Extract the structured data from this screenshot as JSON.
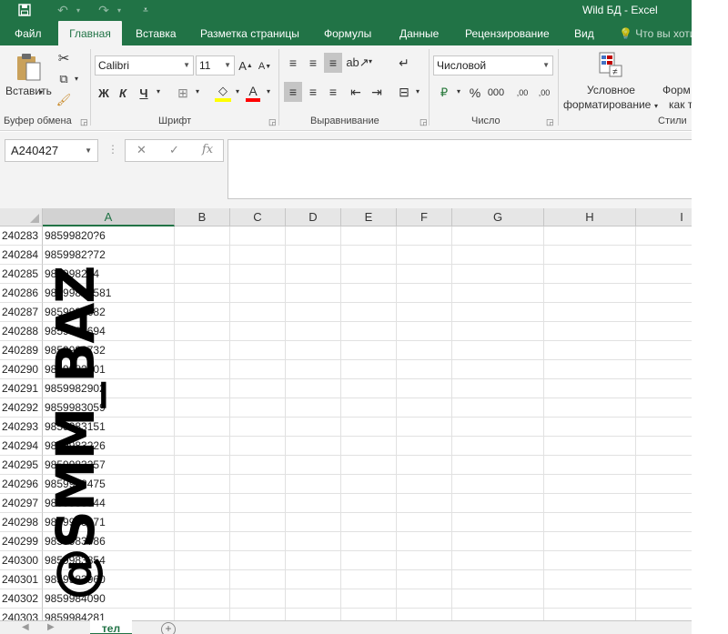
{
  "window": {
    "title": "Wild БД - Excel",
    "icons": {
      "save": "save-icon",
      "undo": "undo-icon",
      "redo": "redo-icon",
      "customize": "customize-qat-icon"
    }
  },
  "tabs": [
    {
      "label": "Файл"
    },
    {
      "label": "Главная",
      "active": true
    },
    {
      "label": "Вставка"
    },
    {
      "label": "Разметка страницы"
    },
    {
      "label": "Формулы"
    },
    {
      "label": "Данные"
    },
    {
      "label": "Рецензирование"
    },
    {
      "label": "Вид"
    }
  ],
  "tell_me": "Что вы хоти",
  "ribbon": {
    "clipboard": {
      "paste_label": "Вставить",
      "group_label": "Буфер обмена"
    },
    "font": {
      "font_name": "Calibri",
      "font_size": "11",
      "bold": "Ж",
      "italic": "К",
      "underline": "Ч",
      "group_label": "Шрифт"
    },
    "alignment": {
      "group_label": "Выравнивание"
    },
    "number": {
      "format": "Числовой",
      "percent": "%",
      "thousands": "000",
      "dec_inc": ",00",
      "dec_dec": ",00",
      "group_label": "Число"
    },
    "styles": {
      "conditional_label_1": "Условное",
      "conditional_label_2": "форматирование",
      "format_table_1": "Форм",
      "format_table_2": "как т",
      "group_label": "Стили"
    }
  },
  "formula_bar": {
    "name_box": "A240427",
    "fx": "fx",
    "value": ""
  },
  "columns": [
    "A",
    "B",
    "C",
    "D",
    "E",
    "F",
    "G",
    "H",
    "I"
  ],
  "rows": [
    {
      "num": "240283",
      "a": "98599820?6"
    },
    {
      "num": "240284",
      "a": "9859982?72"
    },
    {
      "num": "240285",
      "a": "9859982?4"
    },
    {
      "num": "240286",
      "a": "98599826581"
    },
    {
      "num": "240287",
      "a": "9859982682"
    },
    {
      "num": "240288",
      "a": "9859982694"
    },
    {
      "num": "240289",
      "a": "9859982732"
    },
    {
      "num": "240290",
      "a": "9859982801"
    },
    {
      "num": "240291",
      "a": "9859982902"
    },
    {
      "num": "240292",
      "a": "9859983059"
    },
    {
      "num": "240293",
      "a": "9859983151"
    },
    {
      "num": "240294",
      "a": "9859983226"
    },
    {
      "num": "240295",
      "a": "9859983257"
    },
    {
      "num": "240296",
      "a": "9859983475"
    },
    {
      "num": "240297",
      "a": "9859983544"
    },
    {
      "num": "240298",
      "a": "9859983671"
    },
    {
      "num": "240299",
      "a": "9859983786"
    },
    {
      "num": "240300",
      "a": "9859983854"
    },
    {
      "num": "240301",
      "a": "9859983960"
    },
    {
      "num": "240302",
      "a": "9859984090"
    },
    {
      "num": "240303",
      "a": "9859984281"
    }
  ],
  "watermark": "@SMM_BAZ",
  "sheet": {
    "name": "тел",
    "add_icon": "add-sheet-icon"
  }
}
